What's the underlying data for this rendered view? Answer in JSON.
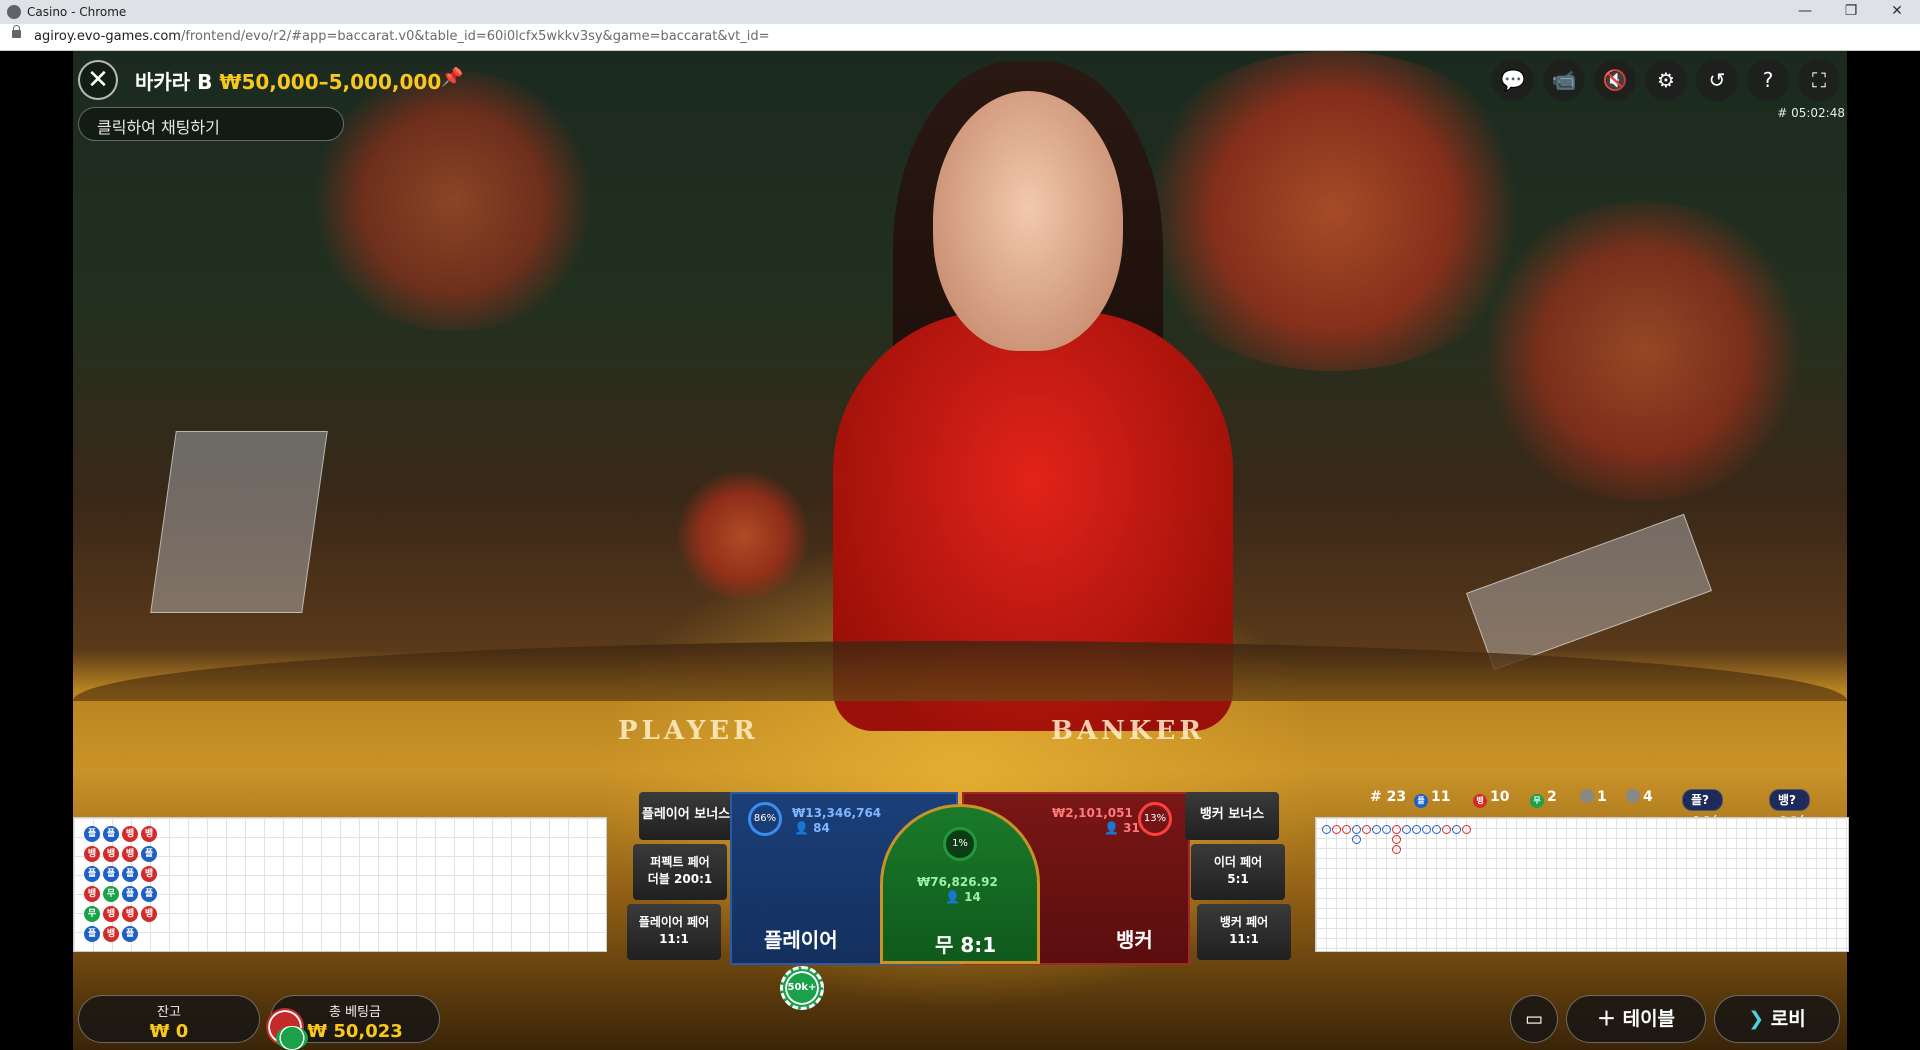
{
  "window": {
    "title": "Casino - Chrome",
    "minimize": "—",
    "maximize": "❐",
    "close": "✕"
  },
  "address": {
    "host": "agiroy.evo-games.com",
    "path": "/frontend/evo/r2/#app=baccarat.v0&table_id=60i0lcfx5wkkv3sy&game=baccarat&vt_id="
  },
  "game": {
    "name": "바카라 B",
    "limits": "₩50,000–5,000,000",
    "round_id": "# 05:02:48"
  },
  "chat": {
    "placeholder": "클릭하여 채팅하기"
  },
  "felt": {
    "player": "PLAYER",
    "banker": "BANKER"
  },
  "top_icons": [
    "chat-icon",
    "video-icon",
    "mute-icon",
    "settings-icon",
    "history-icon",
    "help-icon",
    "fullscreen-icon"
  ],
  "stats": {
    "rounds": "# 23",
    "player_label": "플",
    "player_count": "11",
    "banker_label": "뱅",
    "banker_count": "10",
    "tie_label": "무",
    "tie_count": "2",
    "player_pair": "1",
    "banker_pair": "4",
    "player_ask": "플?",
    "banker_ask": "뱅?"
  },
  "bets": {
    "player_bonus": "플레이어 보너스",
    "perfect_pair": "퍼펙트 페어",
    "perfect_pair_odds": "더블 200:1",
    "player_pair": "플레이어 페어",
    "player_pair_odds": "11:1",
    "banker_bonus": "뱅커 보너스",
    "either_pair": "이더 페어",
    "either_pair_odds": "5:1",
    "banker_pair": "뱅커 페어",
    "banker_pair_odds": "11:1",
    "player": {
      "label": "플레이어",
      "pct": "86%",
      "amount": "₩13,346,764",
      "count": "84"
    },
    "tie": {
      "label": "무",
      "odds": "8:1",
      "pct": "1%",
      "amount": "₩76,826.92",
      "count": "14"
    },
    "banker": {
      "label": "뱅커",
      "pct": "13%",
      "amount": "₩2,101,051",
      "count": "31"
    },
    "chip": "50k+"
  },
  "bottom": {
    "balance_label": "잔고",
    "balance": "₩ 0",
    "total_label": "총 베팅금",
    "total": "₩ 50,023",
    "tables": "테이블",
    "lobby": "로비"
  },
  "colors": {
    "player": "#1e5fc8",
    "banker": "#d42a2a",
    "tie": "#1aa14a",
    "gold": "#f8c81c"
  }
}
